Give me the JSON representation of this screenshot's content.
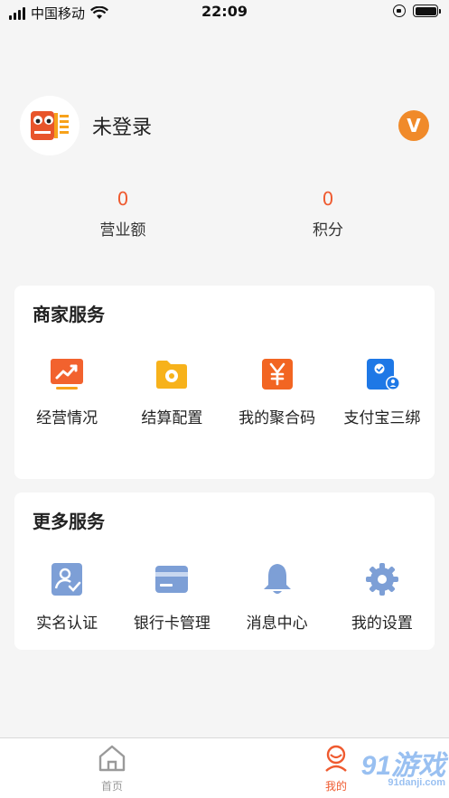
{
  "status_bar": {
    "carrier": "中国移动",
    "time": "22:09"
  },
  "profile": {
    "username": "未登录",
    "vip_label": "V"
  },
  "stats": [
    {
      "value": "0",
      "label": "营业额"
    },
    {
      "value": "0",
      "label": "积分"
    }
  ],
  "merchant_services": {
    "title": "商家服务",
    "items": [
      {
        "label": "经营情况",
        "icon": "chart-trend-icon"
      },
      {
        "label": "结算配置",
        "icon": "settings-folder-icon"
      },
      {
        "label": "我的聚合码",
        "icon": "yuan-icon"
      },
      {
        "label": "支付宝三绑",
        "icon": "alipay-bind-icon"
      }
    ]
  },
  "more_services": {
    "title": "更多服务",
    "items": [
      {
        "label": "实名认证",
        "icon": "id-verify-icon"
      },
      {
        "label": "银行卡管理",
        "icon": "bank-card-icon"
      },
      {
        "label": "消息中心",
        "icon": "bell-icon"
      },
      {
        "label": "我的设置",
        "icon": "gear-icon"
      }
    ]
  },
  "tabbar": {
    "home_label": "首页",
    "mine_label": "我的"
  },
  "watermark": {
    "text": "91游戏",
    "sub": "91danji.com"
  },
  "colors": {
    "accent": "#ef5a2f",
    "vip": "#f08a2a",
    "service_blue": "#7d9fd6"
  }
}
